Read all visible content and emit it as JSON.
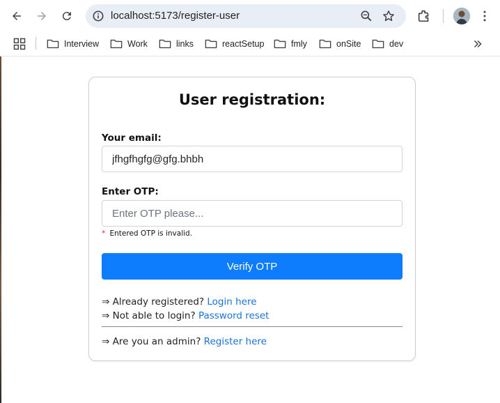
{
  "browser": {
    "url": "localhost:5173/register-user",
    "bookmarks": [
      "Interview",
      "Work",
      "links",
      "reactSetup",
      "fmly",
      "onSite",
      "dev"
    ]
  },
  "form": {
    "title": "User registration:",
    "email_label": "Your email:",
    "email_value": "jfhgfhgfg@gfg.bhbh",
    "otp_label": "Enter OTP:",
    "otp_placeholder": "Enter OTP please...",
    "otp_error_marker": "*",
    "otp_error": "Entered OTP is invalid.",
    "verify_button": "Verify OTP"
  },
  "links": {
    "registered_text": "⇒ Already registered?",
    "login_link": "Login here",
    "unable_text": "⇒ Not able to login?",
    "reset_link": "Password reset",
    "admin_text": "⇒ Are you an admin?",
    "admin_link": "Register here"
  },
  "colors": {
    "primary": "#0d7dfd",
    "link": "#1a73d9",
    "error_marker": "#dc3545"
  }
}
